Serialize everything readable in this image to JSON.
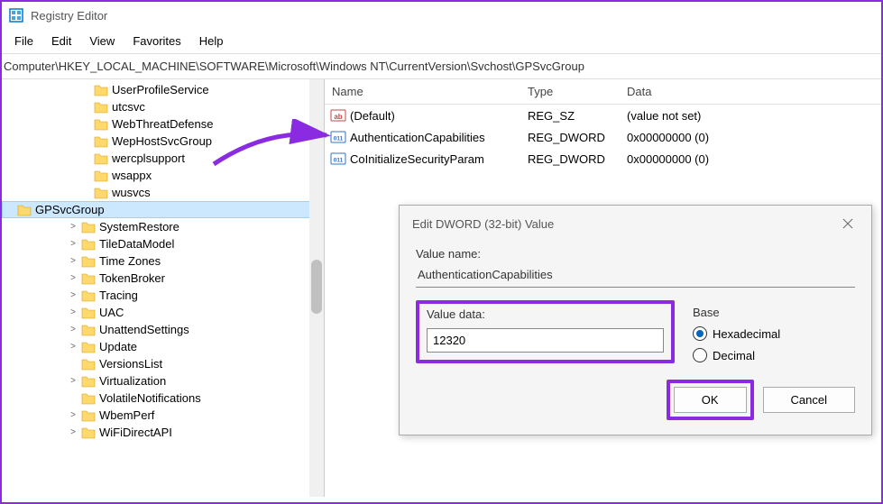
{
  "window": {
    "title": "Registry Editor"
  },
  "menu": {
    "file": "File",
    "edit": "Edit",
    "view": "View",
    "favorites": "Favorites",
    "help": "Help"
  },
  "address": {
    "path": "Computer\\HKEY_LOCAL_MACHINE\\SOFTWARE\\Microsoft\\Windows NT\\CurrentVersion\\Svchost\\GPSvcGroup"
  },
  "tree": {
    "items": [
      {
        "label": "UserProfileService",
        "expander": "",
        "indent": "indent-2"
      },
      {
        "label": "utcsvc",
        "expander": "",
        "indent": "indent-2"
      },
      {
        "label": "WebThreatDefense",
        "expander": "",
        "indent": "indent-2"
      },
      {
        "label": "WepHostSvcGroup",
        "expander": "",
        "indent": "indent-2"
      },
      {
        "label": "wercplsupport",
        "expander": "",
        "indent": "indent-2"
      },
      {
        "label": "wsappx",
        "expander": "",
        "indent": "indent-2"
      },
      {
        "label": "wusvcs",
        "expander": "",
        "indent": "indent-2"
      },
      {
        "label": "GPSvcGroup",
        "expander": "",
        "indent": "indent-2",
        "selected": true
      },
      {
        "label": "SystemRestore",
        "expander": ">",
        "indent": "indent-1"
      },
      {
        "label": "TileDataModel",
        "expander": ">",
        "indent": "indent-1"
      },
      {
        "label": "Time Zones",
        "expander": ">",
        "indent": "indent-1"
      },
      {
        "label": "TokenBroker",
        "expander": ">",
        "indent": "indent-1"
      },
      {
        "label": "Tracing",
        "expander": ">",
        "indent": "indent-1"
      },
      {
        "label": "UAC",
        "expander": ">",
        "indent": "indent-1"
      },
      {
        "label": "UnattendSettings",
        "expander": ">",
        "indent": "indent-1"
      },
      {
        "label": "Update",
        "expander": ">",
        "indent": "indent-1"
      },
      {
        "label": "VersionsList",
        "expander": "",
        "indent": "indent-1"
      },
      {
        "label": "Virtualization",
        "expander": ">",
        "indent": "indent-1"
      },
      {
        "label": "VolatileNotifications",
        "expander": "",
        "indent": "indent-1"
      },
      {
        "label": "WbemPerf",
        "expander": ">",
        "indent": "indent-1"
      },
      {
        "label": "WiFiDirectAPI",
        "expander": ">",
        "indent": "indent-1"
      }
    ]
  },
  "columns": {
    "name": "Name",
    "type": "Type",
    "data": "Data"
  },
  "values": [
    {
      "icon": "string",
      "name": "(Default)",
      "type": "REG_SZ",
      "data": "(value not set)"
    },
    {
      "icon": "dword",
      "name": "AuthenticationCapabilities",
      "type": "REG_DWORD",
      "data": "0x00000000 (0)"
    },
    {
      "icon": "dword",
      "name": "CoInitializeSecurityParam",
      "type": "REG_DWORD",
      "data": "0x00000000 (0)"
    }
  ],
  "dialog": {
    "title": "Edit DWORD (32-bit) Value",
    "value_name_label": "Value name:",
    "value_name": "AuthenticationCapabilities",
    "value_data_label": "Value data:",
    "value_data": "12320",
    "base_label": "Base",
    "hex_label": "Hexadecimal",
    "dec_label": "Decimal",
    "ok": "OK",
    "cancel": "Cancel"
  }
}
